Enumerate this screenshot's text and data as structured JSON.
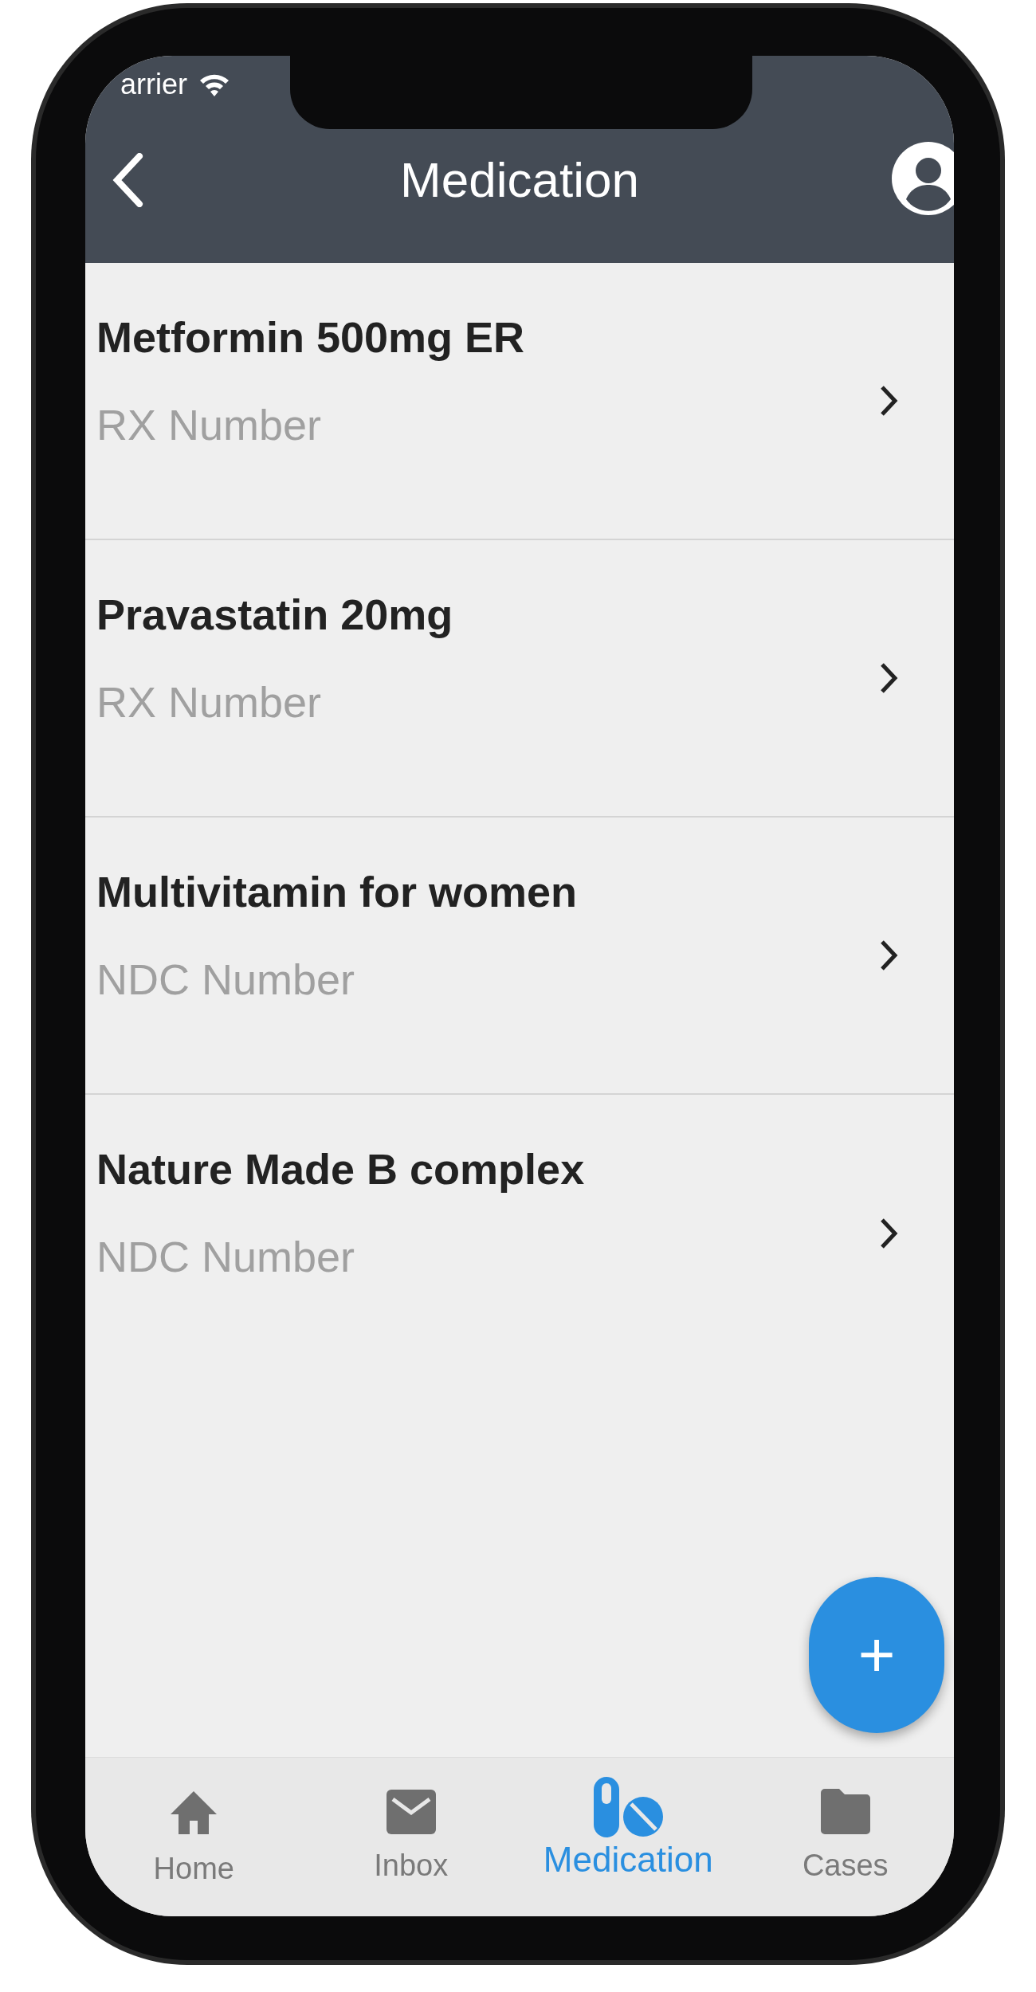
{
  "status_bar": {
    "carrier": "arrier"
  },
  "header": {
    "title": "Medication"
  },
  "medications": [
    {
      "name": "Metformin 500mg ER",
      "subtitle": "RX Number"
    },
    {
      "name": "Pravastatin 20mg",
      "subtitle": "RX Number"
    },
    {
      "name": "Multivitamin for women",
      "subtitle": "NDC Number"
    },
    {
      "name": "Nature Made B complex",
      "subtitle": "NDC Number"
    }
  ],
  "fab": {
    "label": "+"
  },
  "tabs": [
    {
      "label": "Home",
      "kind": "home",
      "selected": false
    },
    {
      "label": "Inbox",
      "kind": "inbox",
      "selected": false
    },
    {
      "label": "Medication",
      "kind": "medication",
      "selected": true
    },
    {
      "label": "Cases",
      "kind": "cases",
      "selected": false
    }
  ]
}
